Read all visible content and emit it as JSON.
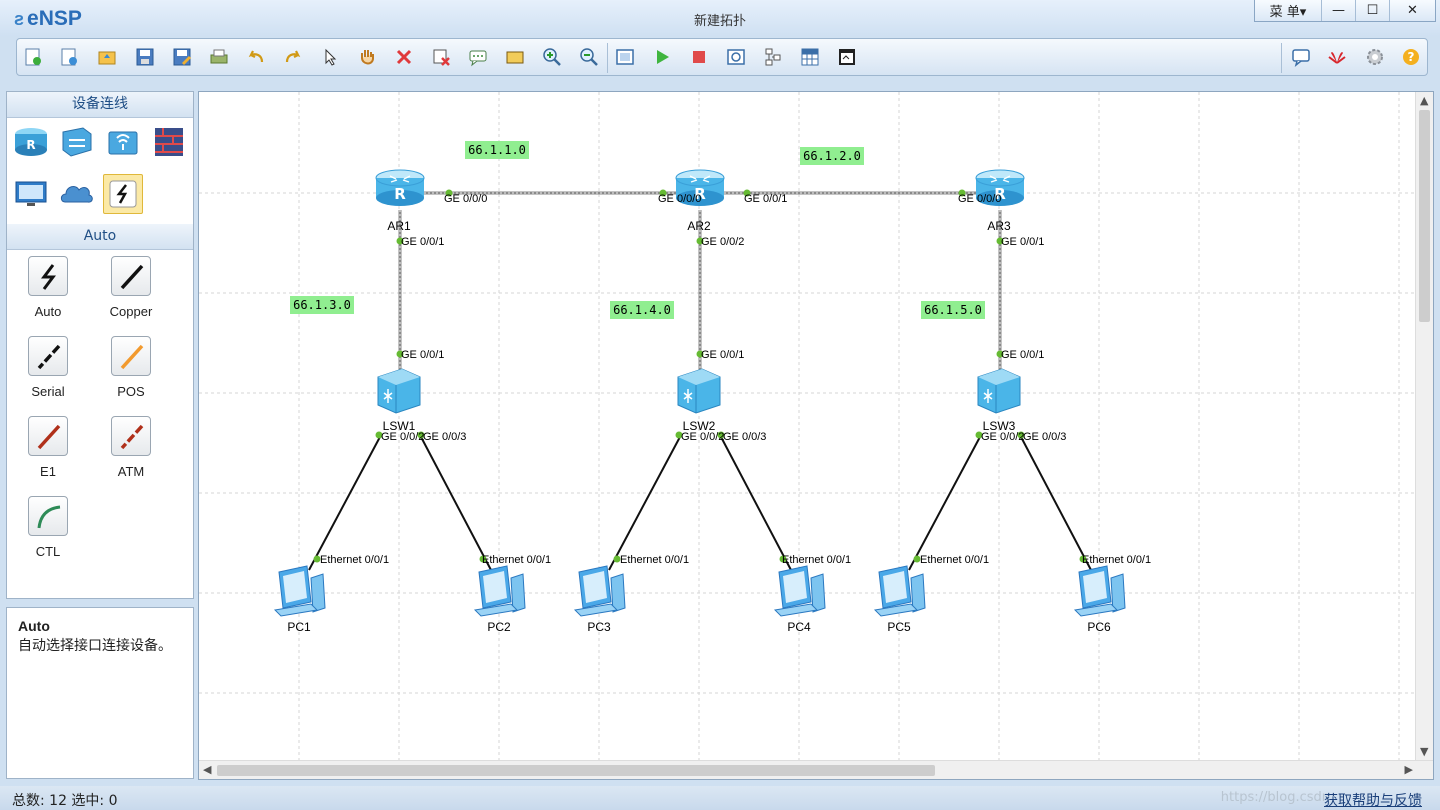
{
  "app": {
    "name": "eNSP",
    "window_title": "新建拓扑"
  },
  "window_buttons": {
    "menu": "菜 单▾",
    "minimize": "—",
    "maximize": "☐",
    "close": "✕"
  },
  "toolbar": {
    "icons": [
      "new-topology-icon",
      "new-lab-icon",
      "open-icon",
      "save-icon",
      "save-as-icon",
      "print-icon",
      "undo-icon",
      "redo-icon",
      "select-icon",
      "pan-hand-icon",
      "delete-icon",
      "delete-link-icon",
      "text-icon",
      "rectangle-icon",
      "zoom-in-icon",
      "zoom-out-icon",
      "fit-view-icon",
      "start-device-icon",
      "stop-device-icon",
      "capture-icon",
      "topology-icon",
      "grid-icon",
      "terminal-icon"
    ],
    "right_icons": [
      "message-icon",
      "huawei-icon",
      "settings-icon",
      "help-icon"
    ]
  },
  "left_panel": {
    "devices_header": "设备连线",
    "device_categories": [
      "router-icon",
      "switch-icon",
      "wireless-icon",
      "firewall-icon",
      "pc-icon",
      "cloud-icon",
      "connection-icon"
    ],
    "cable_header": "Auto",
    "cables": [
      {
        "name": "Auto",
        "color": "#111111"
      },
      {
        "name": "Copper",
        "color": "#111111"
      },
      {
        "name": "Serial",
        "color": "#111111"
      },
      {
        "name": "POS",
        "color": "#f29a2e"
      },
      {
        "name": "E1",
        "color": "#b0301a"
      },
      {
        "name": "ATM",
        "color": "#b0301a"
      },
      {
        "name": "CTL",
        "color": "#2e8b57"
      }
    ]
  },
  "info": {
    "title": "Auto",
    "description": "自动选择接口连接设备。"
  },
  "topology": {
    "networks": [
      "66.1.1.0",
      "66.1.2.0",
      "66.1.3.0",
      "66.1.4.0",
      "66.1.5.0"
    ],
    "routers": [
      "AR1",
      "AR2",
      "AR3"
    ],
    "switches": [
      "LSW1",
      "LSW2",
      "LSW3"
    ],
    "pcs": [
      "PC1",
      "PC2",
      "PC3",
      "PC4",
      "PC5",
      "PC6"
    ],
    "ports": {
      "ar1_ge000": "GE 0/0/0",
      "ar1_ge001": "GE 0/0/1",
      "ar2_ge000": "GE 0/0/0",
      "ar2_ge001": "GE 0/0/1",
      "ar2_ge002": "GE 0/0/2",
      "ar3_ge000": "GE 0/0/0",
      "ar3_ge001": "GE 0/0/1",
      "sw_up": "GE 0/0/1",
      "sw_down_left": "GE 0/0/2",
      "sw_down_right": "GE 0/0/3",
      "pc_eth": "Ethernet 0/0/1"
    },
    "colors": {
      "net_label_bg": "#90ee90",
      "port_dot": "#66bb33",
      "link": "#111111",
      "trunk_link": "#888888"
    }
  },
  "status": {
    "total_label": "总数: 12  选中: 0",
    "help_link": "获取帮助与反馈",
    "watermark": "https://blog.csdn"
  }
}
